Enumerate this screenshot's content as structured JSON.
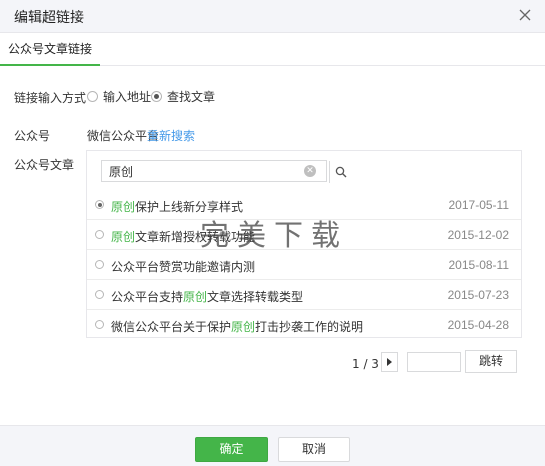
{
  "dialog": {
    "title": "编辑超链接",
    "close_icon": "close-icon"
  },
  "tabs": [
    {
      "label": "公众号文章链接",
      "active": true
    }
  ],
  "link_mode": {
    "label": "链接输入方式",
    "options": [
      {
        "label": "输入地址",
        "selected": false
      },
      {
        "label": "查找文章",
        "selected": true
      }
    ]
  },
  "account": {
    "label": "公众号",
    "name": "微信公众平台",
    "research_link": "重新搜索"
  },
  "articles": {
    "label": "公众号文章",
    "search": {
      "value": "原创",
      "placeholder": ""
    },
    "items": [
      {
        "prefix": "",
        "keyword": "原创",
        "suffix": "保护上线新分享样式",
        "date": "2017-05-11",
        "selected": true
      },
      {
        "prefix": "",
        "keyword": "原创",
        "suffix": "文章新增授权转载功能",
        "date": "2015-12-02",
        "selected": false
      },
      {
        "prefix": "公众平台赞赏功能邀请内测",
        "keyword": "",
        "suffix": "",
        "date": "2015-08-11",
        "selected": false
      },
      {
        "prefix": "公众平台支持",
        "keyword": "原创",
        "suffix": "文章选择转载类型",
        "date": "2015-07-23",
        "selected": false
      },
      {
        "prefix": "微信公众平台关于保护",
        "keyword": "原创",
        "suffix": "打击抄袭工作的说明",
        "date": "2015-04-28",
        "selected": false
      }
    ]
  },
  "pager": {
    "text": "1 / 3",
    "jump_label": "跳转",
    "input_value": ""
  },
  "watermark": "完美下载",
  "footer": {
    "ok_label": "确定",
    "cancel_label": "取消"
  },
  "colors": {
    "accent": "#44b549",
    "link": "#459ae9",
    "header_bg": "#f4f5f9"
  }
}
